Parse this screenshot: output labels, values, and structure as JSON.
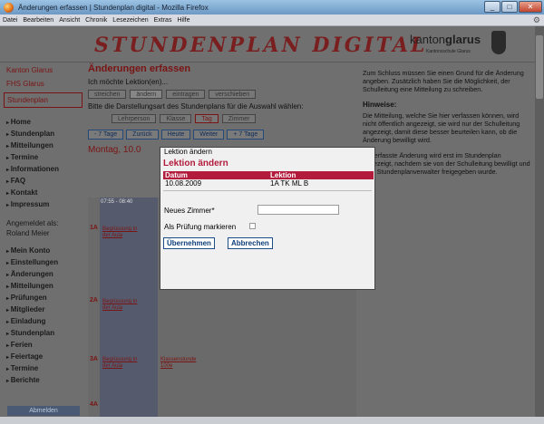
{
  "window": {
    "title": "Änderungen erfassen | Stundenplan digital - Mozilla Firefox",
    "buttons": {
      "minimize": "_",
      "maximize": "□",
      "close": "✕"
    }
  },
  "menu": [
    "Datei",
    "Bearbeiten",
    "Ansicht",
    "Chronik",
    "Lesezeichen",
    "Extras",
    "Hilfe"
  ],
  "header": {
    "logo_text": "STUNDENPLAN DIGITAL",
    "canton_prefix": "kanton",
    "canton_name": "glarus",
    "school": "Kantonsschule Glarus"
  },
  "sidebar": {
    "links": [
      "Kanton Glarus",
      "FHS Glarus"
    ],
    "selected": "Stundenplan",
    "sections": [
      "Home",
      "Stundenplan",
      "Mitteilungen",
      "Termine",
      "Informationen",
      "FAQ",
      "Kontakt",
      "Impressum"
    ],
    "logged_in_label": "Angemeldet als:",
    "user": "Roland Meier",
    "account_sections": [
      "Mein Konto",
      "Einstellungen",
      "Änderungen",
      "Mitteilungen",
      "Prüfungen",
      "Mitglieder"
    ],
    "account_plain": [
      "Einladung",
      "Stundenplan"
    ],
    "more_sections": [
      "Ferien",
      "Feiertage",
      "Termine",
      "Berichte"
    ],
    "logout_button": "Abmelden"
  },
  "main": {
    "title": "Änderungen erfassen",
    "intro": "Ich möchte Lektion(en)...",
    "action_buttons": [
      "streichen",
      "ändern",
      "eintragen",
      "verschieben"
    ],
    "display_prompt": "Bitte die Darstellungsart des Stundenplans für die Auswahl wählen:",
    "view_buttons": [
      "Lehrperson",
      "Klasse",
      "Tag",
      "Zimmer"
    ],
    "nav_buttons": [
      "- 7 Tage",
      "Zurück",
      "Heute",
      "Weiter",
      "+ 7 Tage"
    ],
    "day_heading": "Montag, 10.0",
    "grid": {
      "row_labels": [
        "1A",
        "2A",
        "3A",
        "4A"
      ],
      "time": "07:55 - 08:40",
      "entries": [
        "Begrüssung in der Aula",
        "Begrüssung in der Aula",
        "Begrüssung in der Aula",
        "Klassenstunde 100e"
      ]
    }
  },
  "info": {
    "p1": "Zum Schluss müssen Sie einen Grund für die Änderung angeben. Zusätzlich haben Sie die Möglichkeit, der Schulleitung eine Mitteilung zu schreiben.",
    "hint_title": "Hinweise:",
    "p2": "Die Mitteilung, welche Sie hier verfassen können, wird nicht öffentlich angezeigt, sie wird nur der Schulleitung angezeigt, damit diese besser beurteilen kann, ob die Änderung bewilligt wird.",
    "p3": "Die erfasste Änderung wird erst im Stundenplan angezeigt, nachdem sie von der Schulleitung bewilligt und vom Stundenplanverwalter freigegeben wurde."
  },
  "dialog": {
    "window_title": "Lektion ändern",
    "heading": "Lektion ändern",
    "columns": [
      "Datum",
      "Lektion"
    ],
    "rows": [
      [
        "10.08.2009",
        "1A TK ML B"
      ]
    ],
    "room_label": "Neues Zimmer*",
    "room_value": "",
    "exam_label": "Als Prüfung markieren",
    "exam_checked": false,
    "submit": "Übernehmen",
    "cancel": "Abbrechen"
  },
  "colors": {
    "accent": "#b31b3c",
    "link_blue": "#0d3c78"
  }
}
